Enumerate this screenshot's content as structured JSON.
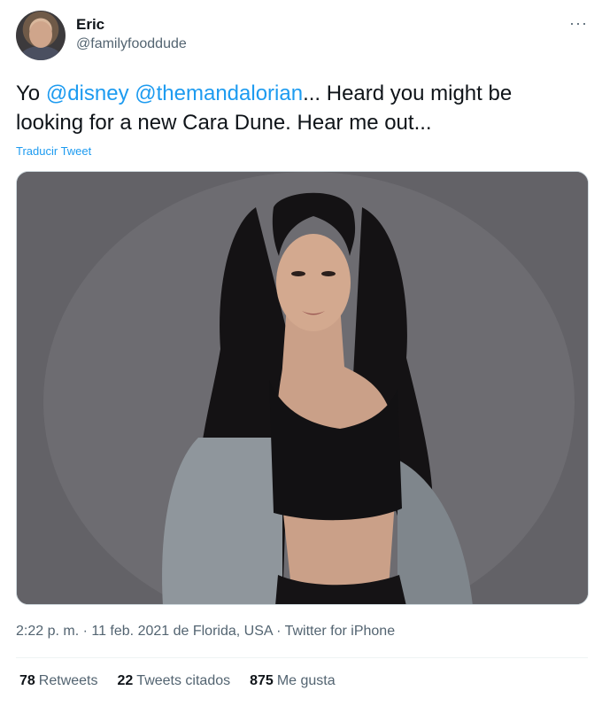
{
  "author": {
    "name": "Eric",
    "handle": "@familyfooddude"
  },
  "more_label": "···",
  "tweet": {
    "text_start": "Yo ",
    "mention1": "@disney",
    "space": " ",
    "mention2": "@themandalorian",
    "text_end": "...  Heard you might be looking for a new Cara Dune.  Hear me out...",
    "translate_label": "Traducir Tweet"
  },
  "meta": {
    "time": "2:22 p. m.",
    "sep1": " · ",
    "date": "11 feb. 2021",
    "location": " de Florida, USA",
    "sep2": " · ",
    "source": "Twitter for iPhone"
  },
  "stats": {
    "retweets_count": "78",
    "retweets_label": "Retweets",
    "quotes_count": "22",
    "quotes_label": "Tweets citados",
    "likes_count": "875",
    "likes_label": "Me gusta"
  },
  "colors": {
    "accent": "#1d9bf0",
    "text": "#0f1419",
    "secondary": "#536471"
  }
}
